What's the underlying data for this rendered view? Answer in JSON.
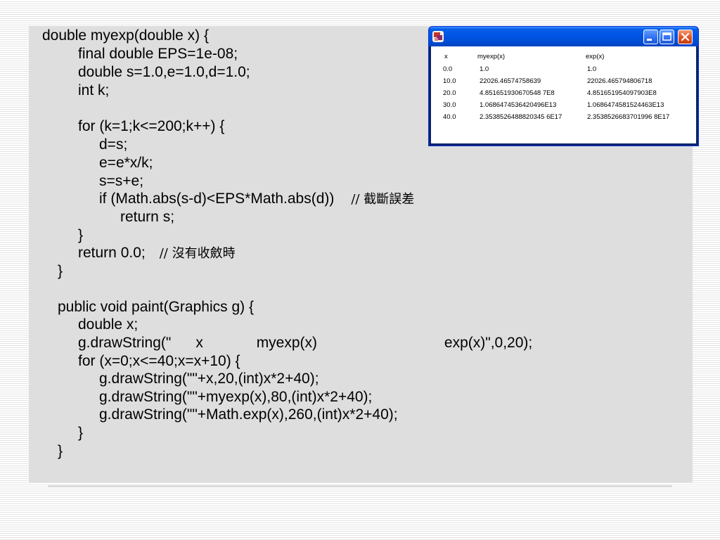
{
  "code": {
    "lines": [
      "double myexp(double x) {",
      "final double EPS=1e-08;",
      "double s=1.0,e=1.0,d=1.0;",
      "int k;",
      "for (k=1;k<=200;k++) {",
      "d=s;",
      "e=e*x/k;",
      "s=s+e;",
      "if (Math.abs(s-d)<EPS*Math.abs(d))",
      "return s;",
      "}",
      "return 0.0;",
      "}",
      "public void paint(Graphics g) {",
      "double x;",
      "g.drawString(\"      x             myexp(x)                               exp(x)\",0,20);",
      "for (x=0;x<=40;x=x+10) {",
      "g.drawString(\"\"+x,20,(int)x*2+40);",
      "g.drawString(\"\"+myexp(x),80,(int)x*2+40);",
      "g.drawString(\"\"+Math.exp(x),260,(int)x*2+40);",
      "}",
      "}"
    ],
    "comments": {
      "truncation_error": "// 截斷誤差",
      "no_convergence": "// 沒有收斂時"
    }
  },
  "applet": {
    "icon": "java-applet-icon",
    "window_controls": [
      "minimize-icon",
      "maximize-icon",
      "close-icon"
    ],
    "table": {
      "headers": [
        "x",
        "myexp(x)",
        "exp(x)"
      ],
      "rows": [
        [
          "0.0",
          "1.0",
          "1.0"
        ],
        [
          "10.0",
          "22026.46574758639",
          "22026.465794806718"
        ],
        [
          "20.0",
          "4.851651930670548 7E8",
          "4.851651954097903E8"
        ],
        [
          "30.0",
          "1.0686474536420496E13",
          "1.0686474581524463E13"
        ],
        [
          "40.0",
          "2.3538526488820345 6E17",
          "2.3538526683701996 8E17"
        ]
      ]
    }
  },
  "colors": {
    "panel": "#dedede",
    "titlebar": "#0055e5",
    "close_button": "#e2531f"
  }
}
